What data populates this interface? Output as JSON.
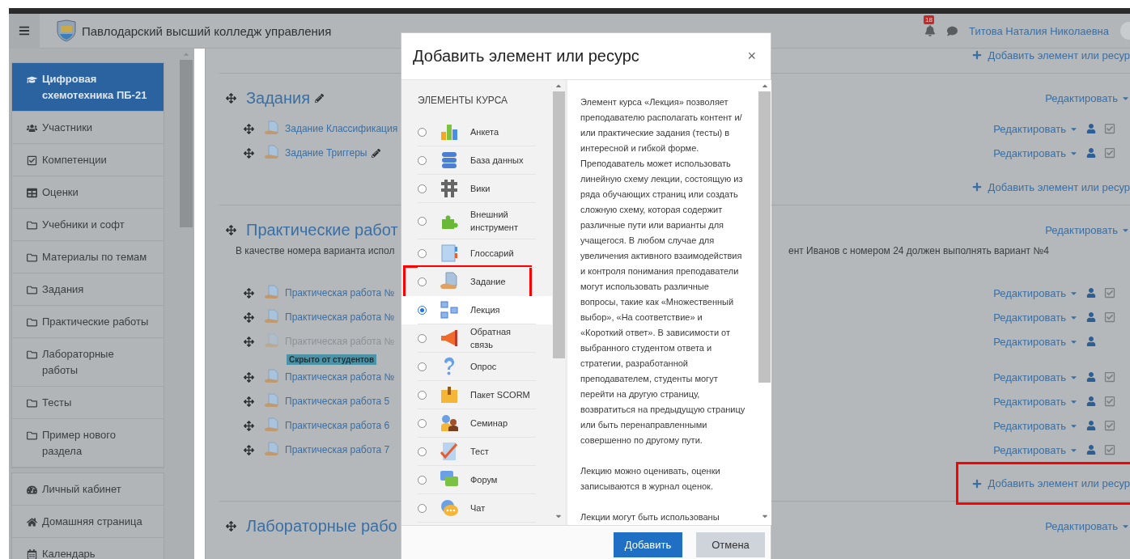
{
  "header": {
    "site_title": "Павлодарский высший колледж управления",
    "notifications_badge": "18",
    "user_name": "Титова Наталия Николаевна"
  },
  "sidebar": {
    "groups": [
      {
        "items": [
          {
            "label": "Цифровая схемотехника ПБ-21",
            "selected": true
          },
          {
            "label": "Участники",
            "selected": false
          },
          {
            "label": "Компетенции",
            "selected": false
          },
          {
            "label": "Оценки",
            "selected": false
          },
          {
            "label": "Учебники и софт",
            "selected": false
          },
          {
            "label": "Материалы по темам",
            "selected": false
          },
          {
            "label": "Задания",
            "selected": false
          },
          {
            "label": "Практические работы",
            "selected": false
          },
          {
            "label": "Лабораторные работы",
            "selected": false
          },
          {
            "label": "Тесты",
            "selected": false
          },
          {
            "label": "Пример нового раздела",
            "selected": false
          }
        ]
      },
      {
        "items": [
          {
            "label": "Личный кабинет",
            "selected": false
          },
          {
            "label": "Домашняя страница",
            "selected": false
          },
          {
            "label": "Календарь",
            "selected": false
          }
        ]
      }
    ]
  },
  "sections": [
    {
      "add_link": {
        "label": "Добавить элемент или ресур",
        "highlighted": false
      }
    },
    {
      "title": "Задания",
      "show_edit_icon": true,
      "edit_label": "Редактировать",
      "activities": [
        {
          "name": "Задание Классификация",
          "show_edit_icon": false,
          "hidden": false,
          "has_completion": true,
          "edit_label": "Редактировать"
        },
        {
          "name": "Задание Триггеры",
          "show_edit_icon": true,
          "hidden": false,
          "has_completion": true,
          "edit_label": "Редактировать"
        }
      ],
      "add_link": {
        "label": "Добавить элемент или ресур",
        "highlighted": false
      }
    },
    {
      "title": "Практические работ",
      "show_edit_icon": false,
      "edit_label": "Редактировать",
      "summary_parts": [
        "В качестве номера варианта испол",
        "ент Иванов с номером 24 должен выполнять вариант №4"
      ],
      "activities": [
        {
          "name": "Практическая работа №",
          "show_edit_icon": false,
          "hidden": false,
          "has_completion": true,
          "edit_label": "Редактировать"
        },
        {
          "name": "Практическая работа №",
          "show_edit_icon": false,
          "hidden": false,
          "has_completion": true,
          "edit_label": "Редактировать"
        },
        {
          "name": "Практическая работа №",
          "show_edit_icon": false,
          "hidden": true,
          "badge": "Скрыто от студентов",
          "has_completion": false,
          "edit_label": "Редактировать"
        },
        {
          "name": "Практическая работа №",
          "show_edit_icon": false,
          "hidden": false,
          "has_completion": true,
          "edit_label": "Редактировать"
        },
        {
          "name": "Практическая работа 5",
          "show_edit_icon": false,
          "hidden": false,
          "has_completion": true,
          "edit_label": "Редактировать"
        },
        {
          "name": "Практическая работа 6",
          "show_edit_icon": false,
          "hidden": false,
          "has_completion": true,
          "edit_label": "Редактировать"
        },
        {
          "name": "Практическая работа 7",
          "show_edit_icon": false,
          "hidden": false,
          "has_completion": true,
          "edit_label": "Редактировать"
        }
      ],
      "add_link": {
        "label": "Добавить элемент или ресур",
        "highlighted": true
      }
    },
    {
      "title": "Лабораторные рабо",
      "show_edit_icon": false,
      "edit_label": "Редактировать"
    }
  ],
  "modal": {
    "title": "Добавить элемент или ресурс",
    "close_label": "×",
    "category": "ЭЛЕМЕНТЫ КУРСА",
    "options": [
      {
        "label": "Анкета",
        "selected": false,
        "highlighted": false
      },
      {
        "label": "База данных",
        "selected": false,
        "highlighted": false
      },
      {
        "label": "Вики",
        "selected": false,
        "highlighted": false
      },
      {
        "label": "Внешний инструмент",
        "selected": false,
        "highlighted": false
      },
      {
        "label": "Глоссарий",
        "selected": false,
        "highlighted": false
      },
      {
        "label": "Задание",
        "selected": false,
        "highlighted": true
      },
      {
        "label": "Лекция",
        "selected": true,
        "highlighted": false
      },
      {
        "label": "Обратная связь",
        "selected": false,
        "highlighted": false
      },
      {
        "label": "Опрос",
        "selected": false,
        "highlighted": false
      },
      {
        "label": "Пакет SCORM",
        "selected": false,
        "highlighted": false
      },
      {
        "label": "Семинар",
        "selected": false,
        "highlighted": false
      },
      {
        "label": "Тест",
        "selected": false,
        "highlighted": false
      },
      {
        "label": "Форум",
        "selected": false,
        "highlighted": false
      },
      {
        "label": "Чат",
        "selected": false,
        "highlighted": false
      }
    ],
    "description": [
      "Элемент курса «Лекция» позволяет преподавателю располагать контент и/или практические задания (тесты) в интересной и гибкой форме. Преподаватель может использовать линейную схему лекции, состоящую из ряда обучающих страниц или создать сложную схему, которая содержит различные пути или варианты для учащегося. В любом случае для увеличения активного взаимодействия и контроля понимания преподаватели могут использовать различные вопросы, такие как «Множественный выбор», «На соответствие» и «Короткий ответ». В зависимости от выбранного студентом ответа и стратегии, разработанной преподавателем, студенты могут перейти на другую страницу, возвратиться на предыдущую страницу или быть перенаправленными совершенно по другому пути.",
      "Лекцию можно оценивать, оценки записываются в журнал оценок.",
      "Лекции могут быть использованы"
    ],
    "buttons": [
      {
        "label": "Добавить",
        "kind": "primary"
      },
      {
        "label": "Отмена",
        "kind": "secondary"
      }
    ]
  }
}
